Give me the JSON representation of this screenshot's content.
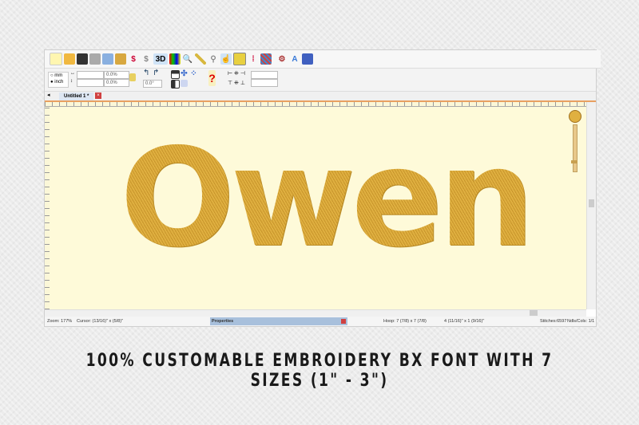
{
  "toolbar": {
    "icons": [
      "new-icon",
      "open-icon",
      "save-icon",
      "print-icon",
      "copy-icon",
      "paste-icon",
      "mirror-icon",
      "rotate-icon",
      "3d-icon",
      "color-chart-icon",
      "magnifier-icon",
      "ruler-icon",
      "hoop-icon",
      "hand-icon",
      "frame-icon",
      "thread-icon",
      "stitch-pattern-icon",
      "settings-icon",
      "lettering-icon",
      "export-icon"
    ],
    "three_d_label": "3D",
    "lettering_label": "A"
  },
  "units": {
    "mm": "mm",
    "inch": "inch",
    "selected": "inch"
  },
  "fields": {
    "width": "",
    "height": "",
    "width_pct": "0.0%",
    "height_pct": "0.0%",
    "rotation": "0.0°",
    "align_x": "",
    "align_y": ""
  },
  "tab": {
    "label": "Untitled 1 *"
  },
  "design": {
    "text": "Owen",
    "color": "#dcaa3b"
  },
  "canvas": {
    "background": "#fefad9"
  },
  "status": {
    "zoom": "Zoom: 177%",
    "cursor": "Cursor: (13/16)\" x (5/8)\"",
    "properties": "Properties",
    "hoop": "Hoop: 7 (7/8) x 7 (7/8)",
    "size": "4 (11/16)\" x 1 (9/16)\"",
    "stitches": "Stitches:6597",
    "ndls": "Ndls/Cols: 1/1"
  },
  "caption": "100% CUSTOMABLE EMBROIDERY BX FONT WITH 7 SIZES (1\" -  3\")"
}
